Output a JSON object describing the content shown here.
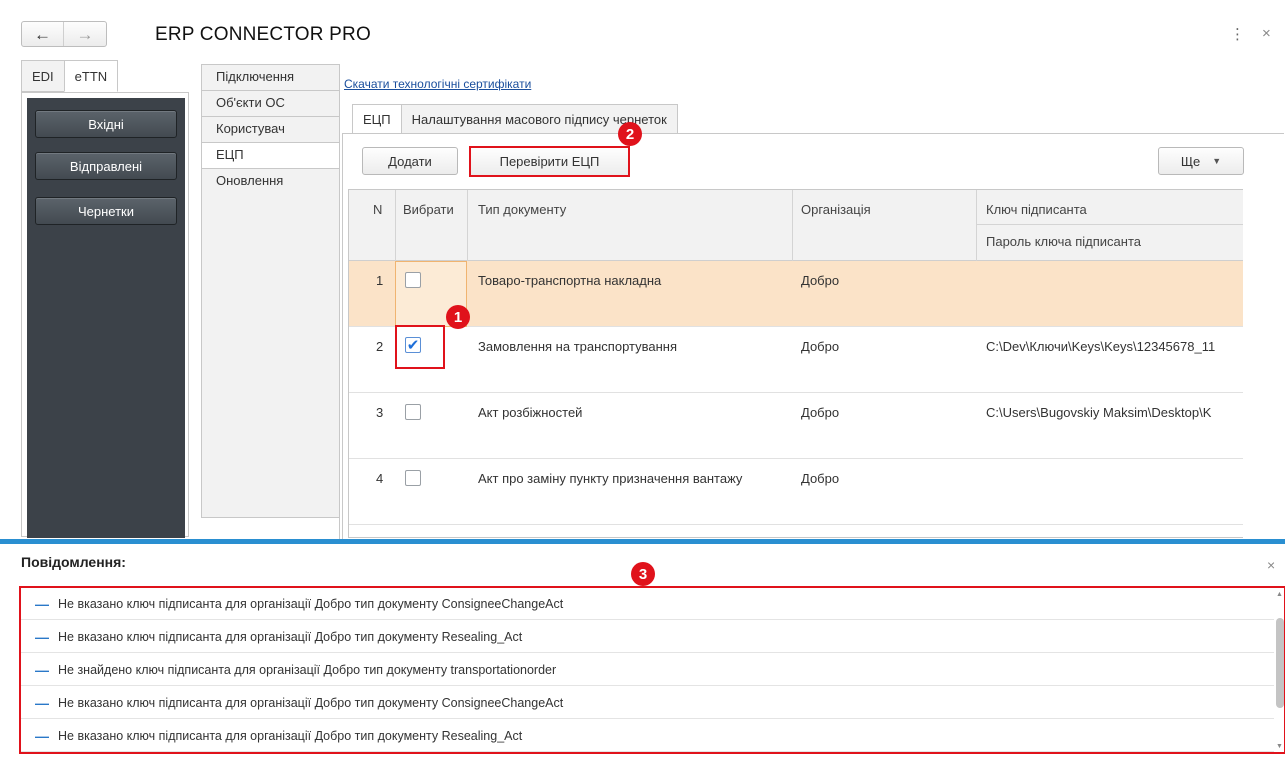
{
  "window": {
    "title": "ERP CONNECTOR PRO",
    "back_icon": "←",
    "forward_icon": "→",
    "menu_icon": "⋮",
    "close_icon": "×"
  },
  "top_tabs": [
    "EDI",
    "eTTN"
  ],
  "left_nav": [
    "Вхідні",
    "Відправлені",
    "Чернетки"
  ],
  "vertical_tabs": [
    "Підключення",
    "Об'єкти ОС",
    "Користувач",
    "ЕЦП",
    "Оновлення"
  ],
  "cert_link": "Скачати технологічні сертифікати",
  "inner_tabs": [
    "ЕЦП",
    "Налаштування масового підпису чернеток"
  ],
  "toolbar": {
    "add": "Додати",
    "check": "Перевірити ЕЦП",
    "more": "Ще",
    "more_arrow": "▼"
  },
  "table": {
    "headers": {
      "n": "N",
      "select": "Вибрати",
      "doc_type": "Тип документу",
      "org": "Організація",
      "key": "Ключ підписанта",
      "key_password": "Пароль ключа підписанта"
    },
    "rows": [
      {
        "n": "1",
        "checked": false,
        "doc_type": "Товаро-транспортна накладна",
        "org": "Добро",
        "key": ""
      },
      {
        "n": "2",
        "checked": true,
        "check_mark": "✔",
        "doc_type": "Замовлення на транспортування",
        "org": "Добро",
        "key": "C:\\Dev\\Ключи\\Keys\\Keys\\12345678_11"
      },
      {
        "n": "3",
        "checked": false,
        "doc_type": "Акт розбіжностей",
        "org": "Добро",
        "key": "C:\\Users\\Bugovskiy Maksim\\Desktop\\K"
      },
      {
        "n": "4",
        "checked": false,
        "doc_type": "Акт про заміну пункту призначення вантажу",
        "org": "Добро",
        "key": ""
      }
    ]
  },
  "badges": [
    "1",
    "2",
    "3"
  ],
  "messages": {
    "title": "Повідомлення:",
    "close_icon": "×",
    "dash": "—",
    "items": [
      "Не вказано ключ підписанта для організації Добро тип документу ConsigneeChangeAct",
      "Не вказано ключ підписанта для організації Добро тип документу Resealing_Act",
      "Не знайдено ключ підписанта для організації Добро тип документу transportationorder",
      "Не вказано ключ підписанта для організації Добро тип документу ConsigneeChangeAct",
      "Не вказано ключ підписанта для організації Добро тип документу Resealing_Act"
    ],
    "scroll_up": "▲",
    "scroll_down": "▼"
  },
  "colors": {
    "accent_red": "#e0121b",
    "divider_blue": "#2a8fd1",
    "link_blue": "#1a4e9c",
    "selected_row": "#fbe3c8",
    "nav_dark": "#3c4249"
  }
}
